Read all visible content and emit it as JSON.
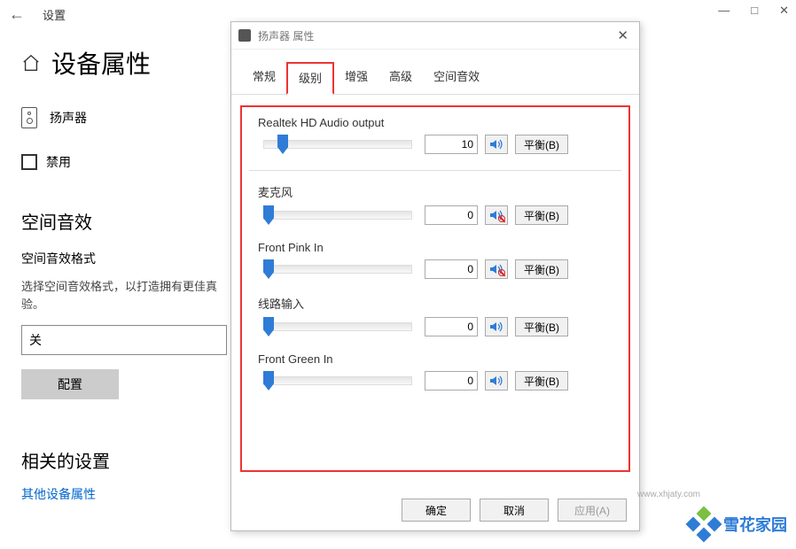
{
  "settings": {
    "top_title": "设置",
    "win": {
      "min": "—",
      "max": "□",
      "close": "✕"
    },
    "page_title": "设备属性",
    "device_name": "扬声器",
    "disable_label": "禁用",
    "spatial_heading": "空间音效",
    "spatial_format_label": "空间音效格式",
    "spatial_desc": "选择空间音效格式，以打造拥有更佳真验。",
    "spatial_value": "关",
    "configure_btn": "配置",
    "related_heading": "相关的设置",
    "related_link": "其他设备属性"
  },
  "dialog": {
    "title": "扬声器 属性",
    "close": "✕",
    "tabs": [
      "常规",
      "级别",
      "增强",
      "高级",
      "空间音效"
    ],
    "active_tab": 1,
    "balance_btn": "平衡(B)",
    "channels": [
      {
        "label": "Realtek HD Audio output",
        "value": "10",
        "muted": false,
        "thumb_pct": 10
      },
      {
        "label": "麦克风",
        "value": "0",
        "muted": true,
        "thumb_pct": 0
      },
      {
        "label": "Front Pink In",
        "value": "0",
        "muted": true,
        "thumb_pct": 0
      },
      {
        "label": "线路输入",
        "value": "0",
        "muted": false,
        "thumb_pct": 0
      },
      {
        "label": "Front Green In",
        "value": "0",
        "muted": false,
        "thumb_pct": 0
      }
    ],
    "buttons": {
      "ok": "确定",
      "cancel": "取消",
      "apply": "应用(A)"
    }
  },
  "watermark": {
    "text": "雪花家园",
    "url": "www.xhjaty.com"
  }
}
